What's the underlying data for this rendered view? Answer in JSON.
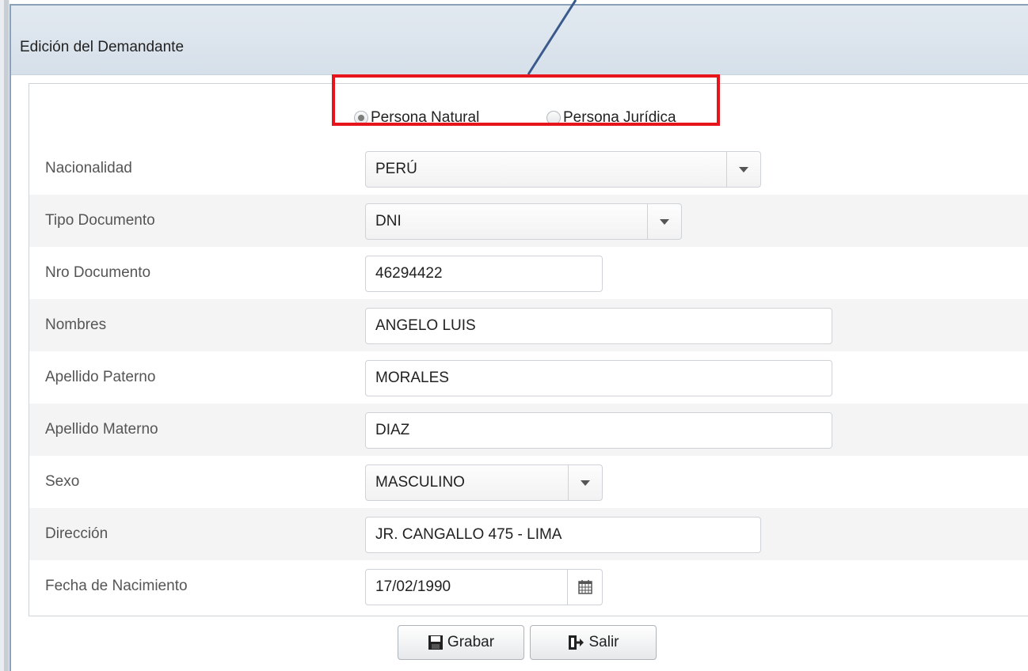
{
  "dialog": {
    "title": "Edición del Demandante"
  },
  "person_type": {
    "options": [
      {
        "label": "Persona Natural",
        "checked": true
      },
      {
        "label": "Persona Jurídica",
        "checked": false
      }
    ]
  },
  "form": {
    "nacionalidad": {
      "label": "Nacionalidad",
      "value": "PERÚ"
    },
    "tipo_documento": {
      "label": "Tipo Documento",
      "value": "DNI"
    },
    "nro_documento": {
      "label": "Nro Documento",
      "value": "46294422"
    },
    "nombres": {
      "label": "Nombres",
      "value": "ANGELO LUIS"
    },
    "apellido_paterno": {
      "label": "Apellido Paterno",
      "value": "MORALES"
    },
    "apellido_materno": {
      "label": "Apellido Materno",
      "value": "DIAZ"
    },
    "sexo": {
      "label": "Sexo",
      "value": "MASCULINO"
    },
    "direccion": {
      "label": "Dirección",
      "value": "JR. CANGALLO 475 - LIMA"
    },
    "fecha_nacimiento": {
      "label": "Fecha de Nacimiento",
      "value": "17/02/1990"
    }
  },
  "buttons": {
    "save": "Grabar",
    "exit": "Salir"
  },
  "icons": {
    "save": "floppy-disk-icon",
    "exit": "exit-door-icon",
    "calendar": "calendar-icon",
    "dropdown": "caret-down-icon"
  },
  "colors": {
    "annotation": "#e8141c",
    "callout_line": "#3a5a8c",
    "title_bar": "#d9e3ec"
  }
}
